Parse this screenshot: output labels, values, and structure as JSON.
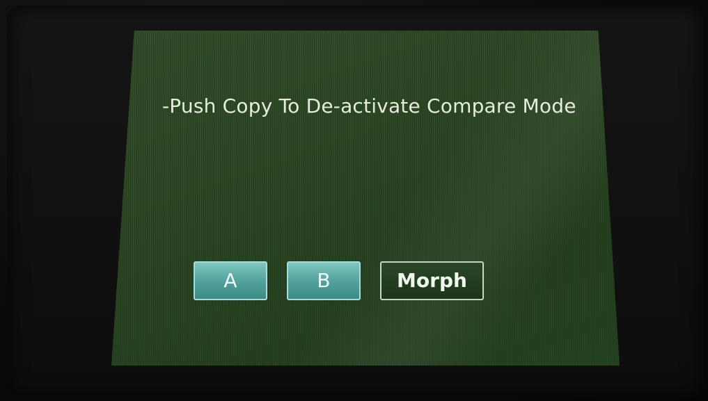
{
  "screen": {
    "message": "-Push Copy To De-activate Compare Mode"
  },
  "buttons": {
    "a_label": "A",
    "b_label": "B",
    "morph_label": "Morph"
  },
  "colors": {
    "screen_background": "#294420",
    "ab_button": "#4fa09c",
    "morph_button": "#1c3419",
    "text": "#e6ecdf"
  }
}
